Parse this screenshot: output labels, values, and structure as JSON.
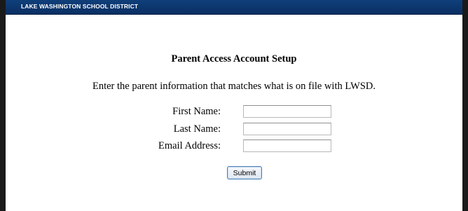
{
  "header": {
    "title": "LAKE WASHINGTON SCHOOL DISTRICT"
  },
  "form": {
    "heading": "Parent Access Account Setup",
    "instructions": "Enter the parent information that matches what is on file with LWSD.",
    "fields": [
      {
        "label": "First Name:",
        "value": "",
        "placeholder": ""
      },
      {
        "label": "Last Name:",
        "value": "",
        "placeholder": ""
      },
      {
        "label": "Email Address:",
        "value": "",
        "placeholder": ""
      }
    ],
    "submit_label": "Submit"
  },
  "colors": {
    "header_background": "#0a2f63",
    "frame": "#1a1a1a",
    "button_border": "#4a7fb5"
  }
}
